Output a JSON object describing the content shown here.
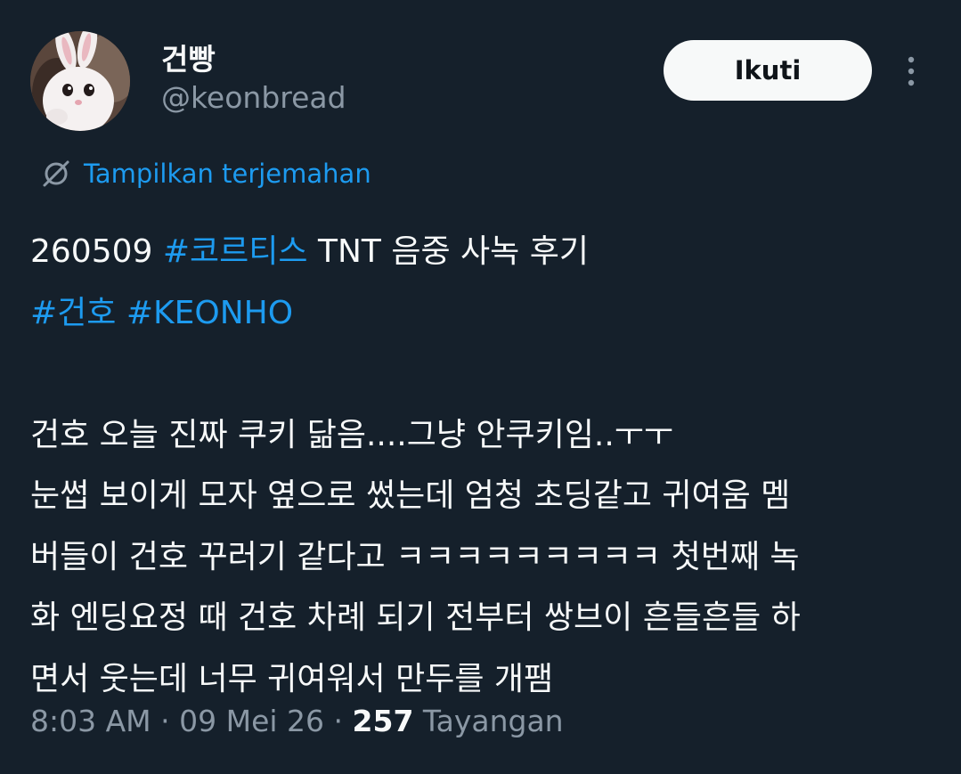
{
  "author": {
    "display_name": "건빵",
    "handle": "@keonbread"
  },
  "follow_button": {
    "label": "Ikuti"
  },
  "translate": {
    "label": "Tampilkan terjemahan"
  },
  "tweet": {
    "line1": {
      "prefix": "260509 ",
      "hashtag": "#코르티스",
      "suffix": " TNT 음중 사녹 후기"
    },
    "line2": {
      "hashtag1": "#건호",
      "hashtag2": "#KEONHO"
    },
    "body_lines": [
      "건호 오늘 진짜 쿠키 닮음....그냥 안쿠키임..ㅜㅜ",
      "눈썹 보이게 모자 옆으로 썼는데 엄청 초딩같고 귀여움 멤",
      "버들이 건호 꾸러기 같다고 ㅋㅋㅋㅋㅋㅋㅋㅋㅋ 첫번째 녹",
      "화 엔딩요정 때 건호 차례 되기 전부터 쌍브이 흔들흔들 하",
      "면서 웃는데 너무 귀여워서 만두를 개팸"
    ]
  },
  "meta": {
    "time": "8:03 AM",
    "separator": " · ",
    "date": "09 Mei 26",
    "views_count": "257",
    "views_label": "Tayangan"
  },
  "colors": {
    "background": "#15202b",
    "text": "#f7f9f9",
    "secondary_text": "#8b98a5",
    "accent": "#1d9bf0"
  },
  "icons": {
    "more": "more-vertical-icon",
    "translate": "translate-globe-icon",
    "avatar": "avatar-image"
  }
}
